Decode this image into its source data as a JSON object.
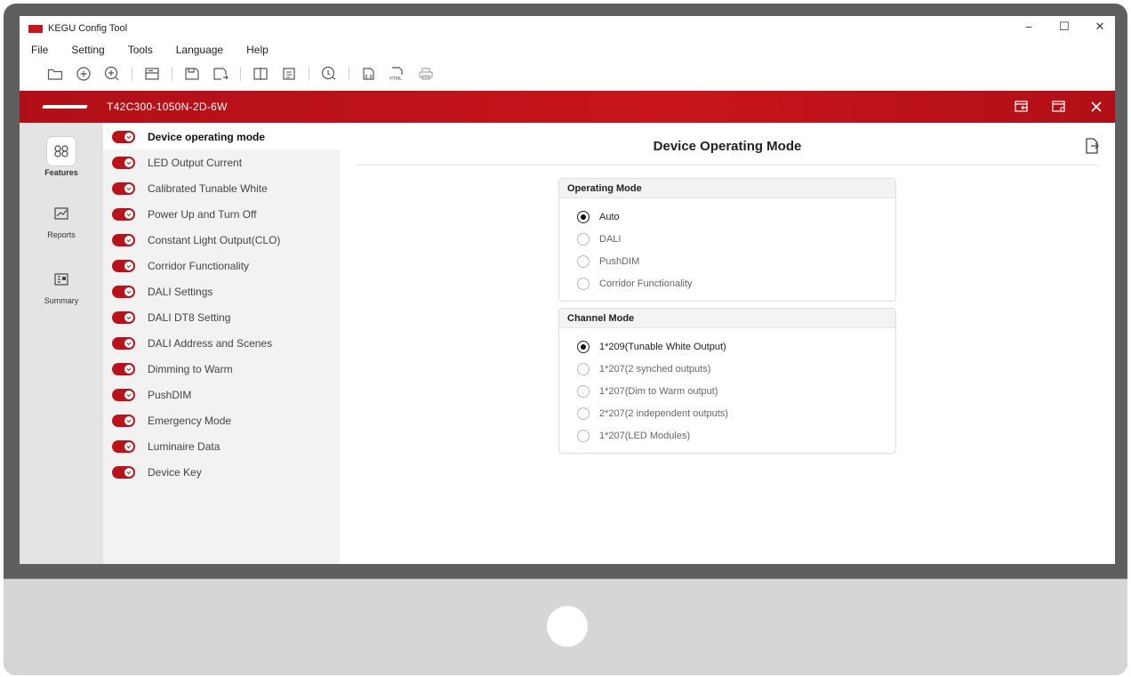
{
  "window": {
    "title": "KEGU Config Tool",
    "controls": [
      "–",
      "☐",
      "✕"
    ]
  },
  "menu": [
    "File",
    "Setting",
    "Tools",
    "Language",
    "Help"
  ],
  "toolbar_icons": [
    "open-folder-icon",
    "new-icon",
    "add-icon",
    "device-icon",
    "save-icon",
    "save-as-icon",
    "compare-icon",
    "report-icon",
    "refresh-icon",
    "export-icon",
    "html-icon",
    "print-icon"
  ],
  "device": {
    "name": "T42C300-1050N-2D-6W",
    "actions": [
      "import-config-icon",
      "settings-config-icon",
      "close-icon"
    ]
  },
  "rail": [
    {
      "label": "Features",
      "icon": "features-icon"
    },
    {
      "label": "Reports",
      "icon": "reports-icon"
    },
    {
      "label": "Summary",
      "icon": "summary-icon"
    }
  ],
  "features": [
    "Device operating mode",
    "LED Output Current",
    "Calibrated Tunable White",
    "Power Up and Turn Off",
    "Constant Light Output(CLO)",
    "Corridor Functionality",
    "DALI Settings",
    "DALI DT8 Setting",
    "DALI Address and Scenes",
    "Dimming to Warm",
    "PushDIM",
    "Emergency Mode",
    "Luminaire Data",
    "Device Key"
  ],
  "main": {
    "title": "Device Operating Mode",
    "operating_mode": {
      "heading": "Operating Mode",
      "options": [
        "Auto",
        "DALI",
        "PushDIM",
        "Corridor Functionality"
      ],
      "selected": "Auto"
    },
    "channel_mode": {
      "heading": "Channel Mode",
      "options": [
        "1*209(Tunable White Output)",
        "1*207(2 synched outputs)",
        "1*207(Dim to Warm output)",
        "2*207(2 independent outputs)",
        "1*207(LED Modules)"
      ],
      "selected": "1*209(Tunable White Output)"
    }
  },
  "colors": {
    "accent_red": "#c8141c",
    "monitor_frame": "#5f5f5f"
  }
}
